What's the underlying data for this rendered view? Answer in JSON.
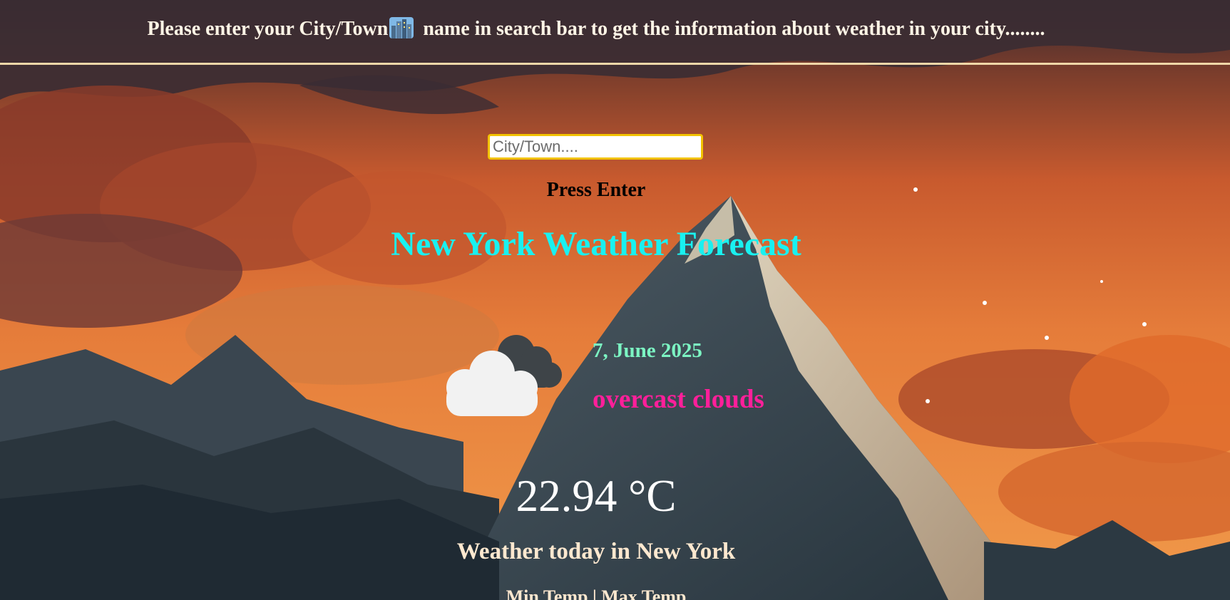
{
  "header": {
    "prefix": "Please enter your City/Town",
    "suffix": " name in search bar to get the information about weather in your city........",
    "emoji_icon": "cityscape-icon"
  },
  "search": {
    "placeholder": "City/Town....",
    "value": "",
    "hint": "Press Enter"
  },
  "forecast": {
    "title": "New York Weather Forecast",
    "date": "7, June 2025",
    "description": "overcast clouds",
    "icon": "overcast-clouds-icon",
    "temperature": "22.94 °C",
    "today_label": "Weather today in New York",
    "minmax_label": "Min Temp | Max Temp"
  },
  "colors": {
    "title": "#19f1f0",
    "date": "#7cf5c3",
    "description": "#ff1f9a",
    "search_border": "#f2c200",
    "divider": "#f0d7a8"
  }
}
